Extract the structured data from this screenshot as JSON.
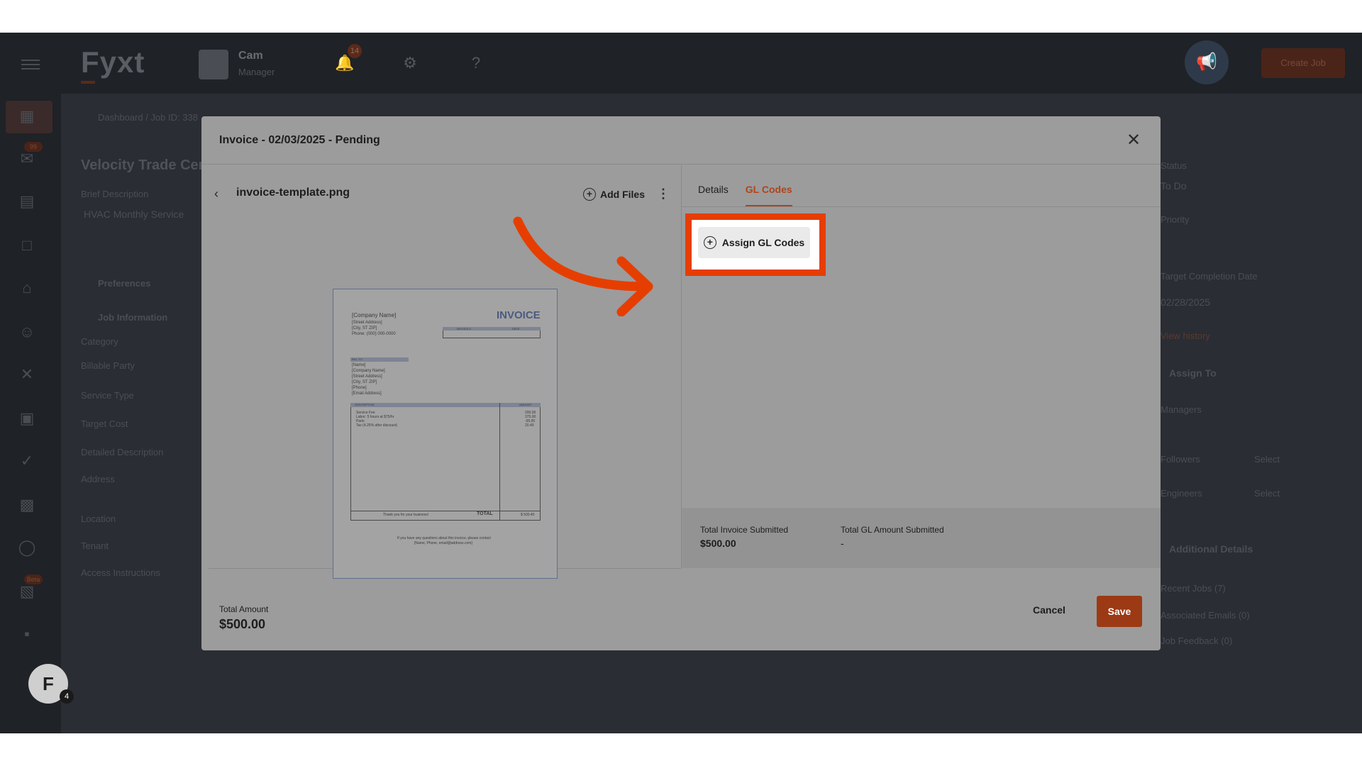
{
  "app": {
    "logo": "Fyxt",
    "user_name": "Cam",
    "user_role": "Manager",
    "notifications_count": "14",
    "create_job_label": "Create Job",
    "user_initial": "F",
    "user_badge": "4"
  },
  "sidebar": {
    "badges": [
      "99",
      "Beta"
    ]
  },
  "background_page": {
    "breadcrumb": "Dashboard / Job ID: 338",
    "title": "Velocity Trade Cen",
    "brief_description_label": "Brief Description",
    "brief_description_value": "HVAC Monthly Service",
    "preferences_label": "Preferences",
    "job_information_label": "Job Information",
    "fields": [
      "Category",
      "Billable Party",
      "Service Type",
      "Target Cost",
      "Detailed Description",
      "Address",
      "Location",
      "Tenant",
      "Access Instructions"
    ],
    "right_fields": [
      "Status",
      "To Do",
      "Priority",
      "Target Completion Date",
      "02/28/2025",
      "View history",
      "Assign To",
      "Managers",
      "Followers",
      "Engineers",
      "Additional Details",
      "Recent Jobs (7)",
      "Associated Emails (0)",
      "Job Feedback (0)"
    ],
    "select_placeholder": "Select"
  },
  "modal": {
    "title": "Invoice - 02/03/2025 - Pending",
    "file_name": "invoice-template.png",
    "add_files_label": "Add Files",
    "tabs": [
      {
        "label": "Details",
        "active": false
      },
      {
        "label": "GL Codes",
        "active": true
      }
    ],
    "assign_gl_codes_label": "Assign GL Codes",
    "total_invoice_submitted_label": "Total Invoice Submitted",
    "total_invoice_submitted_value": "$500.00",
    "total_gl_amount_submitted_label": "Total GL Amount Submitted",
    "total_gl_amount_submitted_value": "-",
    "total_amount_label": "Total Amount",
    "total_amount_value": "$500.00",
    "cancel_label": "Cancel",
    "save_label": "Save"
  },
  "invoice_preview": {
    "title": "INVOICE",
    "company_lines": [
      "[Company Name]",
      "[Street Address]",
      "[City, ST ZIP]",
      "Phone: (000) 000-0000"
    ],
    "invoice_no_label": "INVOICE #",
    "date_label": "DATE",
    "bill_to_label": "BILL TO",
    "bill_to_lines": [
      "[Name]",
      "[Company Name]",
      "[Street Address]",
      "[City, ST ZIP]",
      "[Phone]",
      "[Email Address]"
    ],
    "description_label": "DESCRIPTION",
    "amount_label": "AMOUNT",
    "items": [
      "Service Fee",
      "Labor: 5 hours at $75/hr",
      "Parts",
      "Tax (4.25% after discount)"
    ],
    "amounts": [
      "200.00",
      "375.00",
      "-95.00",
      "20.40"
    ],
    "thanks": "Thank you for your business!",
    "total_label": "TOTAL",
    "total_value": "$ 500.40",
    "contact_line_1": "If you have any questions about this invoice, please contact",
    "contact_line_2": "[Name, Phone, email@address.com]"
  },
  "colors": {
    "accent": "#b0441c",
    "highlight": "#e63e00",
    "save": "#9b3a14"
  }
}
